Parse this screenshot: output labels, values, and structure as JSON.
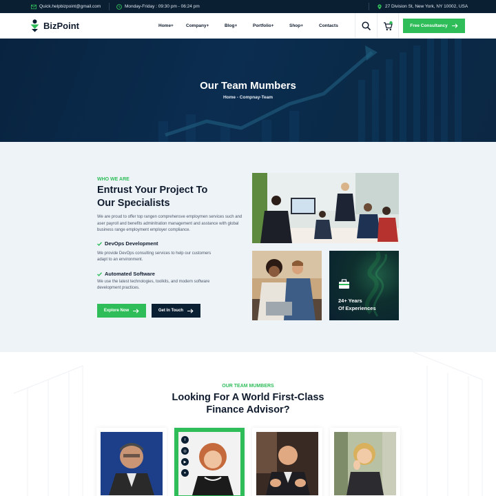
{
  "topbar": {
    "email": "Quick.helpbizpoint@gmail.com",
    "hours": "Monday-Friday : 09:30 pm - 06:24 pm",
    "address": "27 Division St, New York, NY 10002, USA"
  },
  "header": {
    "logo": "BizPoint",
    "nav": [
      {
        "label": "Home+"
      },
      {
        "label": "Company+"
      },
      {
        "label": "Blog+"
      },
      {
        "label": "Portfolio+"
      },
      {
        "label": "Shop+"
      },
      {
        "label": "Contacts"
      }
    ],
    "cta": "Free Consultancy"
  },
  "hero": {
    "title": "Our Team Mumbers",
    "breadcrumb": "Home - Compnay-Team"
  },
  "about": {
    "eyebrow": "WHO WE ARE",
    "title_line1": "Entrust Your Project To",
    "title_line2": "Our Specialists",
    "description": "We are proud to offer top rangen comprehensve employmen services such and aser payroll and benefits adminitration management and asstance with global business range employment employer compliance.",
    "features": [
      {
        "title": "DevOps Development",
        "desc": "We provide DevOps consulting services to help our customers adapt to an environment."
      },
      {
        "title": "Automated Software",
        "desc": "We use the latest technologies, toolkits, and modern software development practices."
      }
    ],
    "btn_explore": "Explore Now",
    "btn_touch": "Get In Touch",
    "experience_line1": "24+ Years",
    "experience_line2": "Of Experiences"
  },
  "team": {
    "eyebrow": "OUR TEAM MUMBERS",
    "title_line1": "Looking For A World First-Class",
    "title_line2": "Finance Advisor?"
  },
  "colors": {
    "accent": "#2fbd59",
    "dark": "#0b1f33",
    "section_bg": "#eef3f8"
  }
}
